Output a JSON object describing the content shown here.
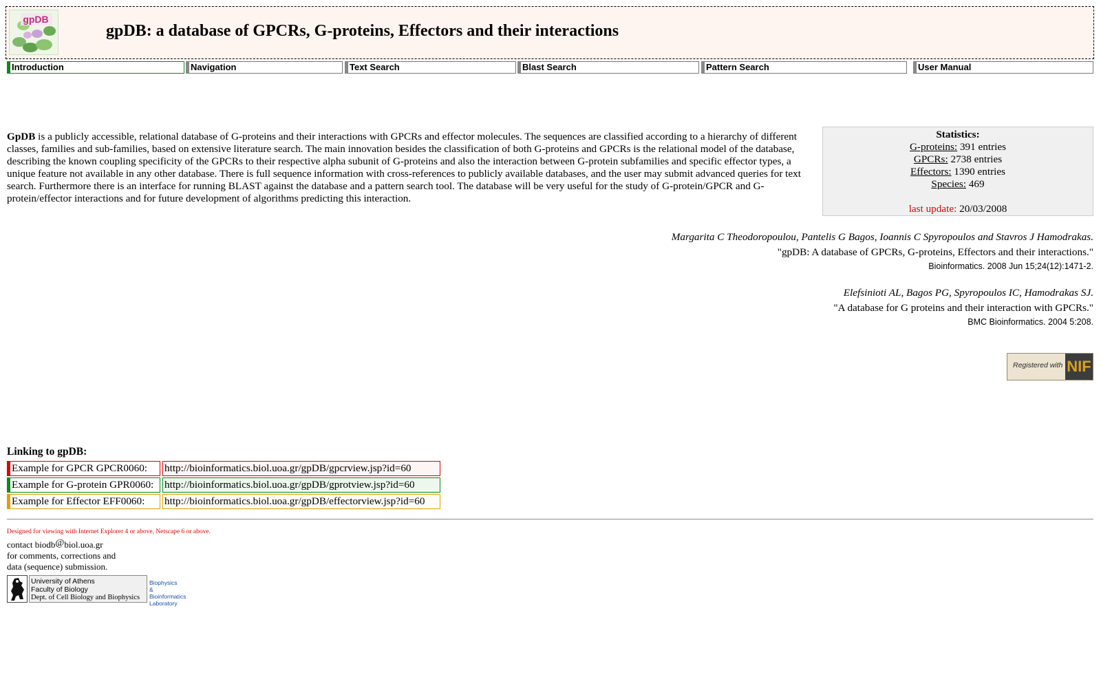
{
  "header": {
    "logo_text": "gpDB",
    "title": "gpDB: a database of GPCRs, G-proteins, Effectors and their interactions"
  },
  "nav": {
    "items": [
      {
        "label": "Introduction"
      },
      {
        "label": "Navigation"
      },
      {
        "label": "Text Search"
      },
      {
        "label": "Blast Search"
      },
      {
        "label": "Pattern Search"
      },
      {
        "label": "User Manual"
      }
    ]
  },
  "intro": {
    "name": "GpDB",
    "text": " is a publicly accessible, relational database of G-proteins and their interactions with GPCRs and effector molecules. The sequences are classified according to a hierarchy of different classes, families and sub-families, based on extensive literature search. The main innovation besides the classification of both G-proteins and GPCRs is the relational model of the database, describing the known coupling specificity of the GPCRs to their respective alpha subunit of G-proteins and also the interaction between G-protein subfamilies and specific effector types, a unique feature not available in any other database. There is full sequence information with cross-references to publicly available databases, and the user may submit advanced queries for text search. Furthermore there is an interface for running BLAST against the database and a pattern search tool. The database will be very useful for the study of G-protein/GPCR and G-protein/effector interactions and for future development of algorithms predicting this interaction."
  },
  "stats": {
    "title": "Statistics:",
    "gproteins_label": "G-proteins:",
    "gproteins_value": " 391 entries",
    "gpcrs_label": "GPCRs:",
    "gpcrs_value": " 2738 entries",
    "effectors_label": "Effectors:",
    "effectors_value": " 1390 entries",
    "species_label": "Species:",
    "species_value": " 469",
    "update_label": "last update:",
    "update_value": " 20/03/2008"
  },
  "citations": [
    {
      "authors": "Margarita C Theodoropoulou, Pantelis G Bagos, Ioannis C Spyropoulos and Stavros J Hamodrakas.",
      "title": "\"gpDB: A database of GPCRs, G-proteins, Effectors and their interactions.\"",
      "journal": "Bioinformatics. 2008 Jun 15;24(12):1471-2."
    },
    {
      "authors": "Elefsinioti AL, Bagos PG, Spyropoulos IC, Hamodrakas SJ.",
      "title": "\"A database for G proteins and their interaction with GPCRs.\"",
      "journal": "BMC Bioinformatics. 2004 5:208."
    }
  ],
  "nif": {
    "text": "Registered with",
    "logo": "NIF"
  },
  "linking": {
    "title": "Linking to gpDB:",
    "rows": [
      {
        "label": "Example for GPCR GPCR0060:",
        "url": "http://bioinformatics.biol.uoa.gr/gpDB/gpcrview.jsp?id=60",
        "color": "#e00000"
      },
      {
        "label": "Example for G-protein GPR0060:",
        "url": "http://bioinformatics.biol.uoa.gr/gpDB/gprotview.jsp?id=60",
        "color": "#0a8a18"
      },
      {
        "label": "Example for Effector EFF0060:",
        "url": "http://bioinformatics.biol.uoa.gr/gpDB/effectorview.jsp?id=60",
        "color": "#e0a000"
      }
    ]
  },
  "footer": {
    "designed": "Designed for viewing with Internet Explorer 4 or above, Netscape 6 or above.",
    "contact_prefix": "contact biodb",
    "contact_at": "@",
    "contact_domain": "biol.uoa.gr",
    "contact_line2": "for comments, corrections and",
    "contact_line3": "data (sequence) submission.",
    "uoa_line1": "University of Athens",
    "uoa_line2": "Faculty of Biology",
    "uoa_line3": "Dept. of Cell Biology and Biophysics",
    "lab_line1": "Biophysics",
    "lab_line2": "& Bioinformatics",
    "lab_line3": "Laboratory"
  }
}
